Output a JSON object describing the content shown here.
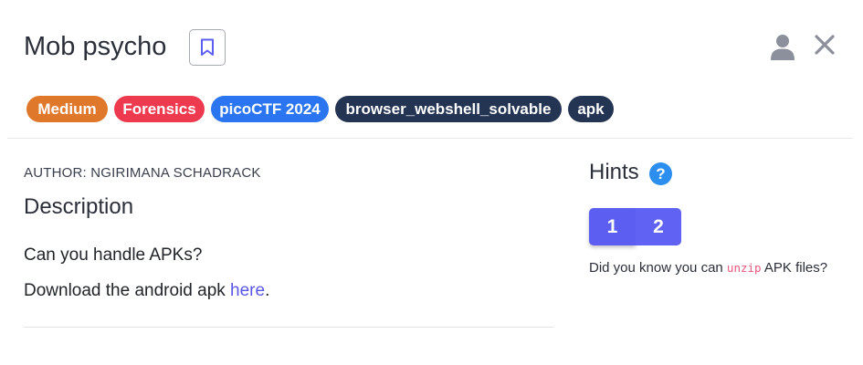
{
  "challenge": {
    "title": "Mob psycho",
    "tags": [
      {
        "label": "Medium",
        "color": "#e0782c"
      },
      {
        "label": "Forensics",
        "color": "#ee3a4e"
      },
      {
        "label": "picoCTF 2024",
        "color": "#2c75f0"
      },
      {
        "label": "browser_webshell_solvable",
        "color": "#243453"
      },
      {
        "label": "apk",
        "color": "#243453"
      }
    ],
    "author": "AUTHOR: NGIRIMANA SCHADRACK",
    "description_heading": "Description",
    "description_line1": "Can you handle APKs?",
    "description_line2_prefix": "Download the android apk ",
    "description_link": "here",
    "description_line2_suffix": "."
  },
  "header": {
    "icons": [
      "bookmark-icon",
      "user-icon",
      "close-icon"
    ]
  },
  "hints": {
    "heading": "Hints",
    "help_glyph": "?",
    "tabs": [
      "1",
      "2"
    ],
    "active_tab": "1",
    "text_prefix": "Did you know you can ",
    "text_code": "unzip",
    "text_suffix": " APK files?"
  },
  "colors": {
    "accent": "#5b5ef0",
    "link": "#5b57e6",
    "code": "#e8577e"
  }
}
